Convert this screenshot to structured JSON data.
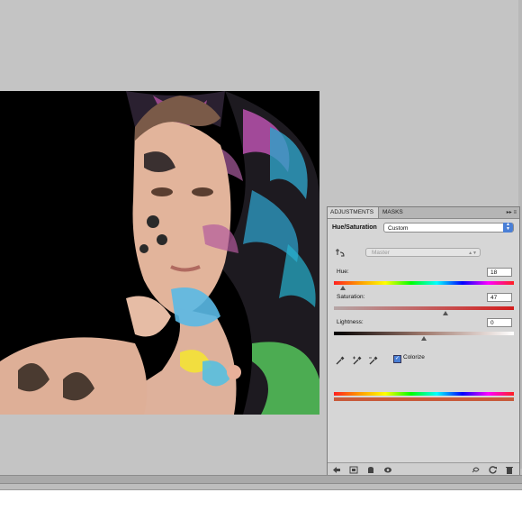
{
  "panel": {
    "tabs": [
      "ADJUSTMENTS",
      "MASKS"
    ],
    "menu_icon": "panel-menu-icon",
    "title": "Hue/Saturation",
    "preset_value": "Custom",
    "channel_value": "Master",
    "hue": {
      "label": "Hue:",
      "value": "18",
      "level": 0.05
    },
    "saturation": {
      "label": "Saturation:",
      "value": "47",
      "level": 0.62
    },
    "lightness": {
      "label": "Lightness:",
      "value": "0",
      "level": 0.5
    },
    "colorize_label": "Colorize",
    "colorize_checked": true
  },
  "icons": [
    "target-adjustment-icon",
    "eyedropper-icon",
    "eyedropper-plus-icon",
    "eyedropper-minus-icon",
    "back-arrow-icon",
    "expand-view-icon",
    "clip-layer-icon",
    "visibility-eye-icon",
    "view-previous-icon",
    "reset-icon",
    "trash-icon"
  ],
  "colors": {
    "workspace": "#c4c4c4",
    "panel": "#d6d6d6",
    "accent": "#4a7fd6"
  }
}
